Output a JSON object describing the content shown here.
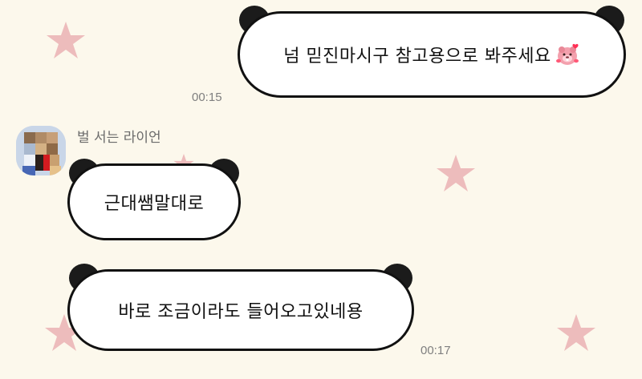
{
  "messages": [
    {
      "id": "m1",
      "side": "right",
      "text": "넘 믿진마시구 참고용으로 봐주세요",
      "emoji": "pink-beaver-emoji",
      "time": "00:15"
    },
    {
      "id": "m2",
      "side": "left",
      "text": "근대쌤말대로",
      "time": ""
    },
    {
      "id": "m3",
      "side": "left",
      "text": "바로 조금이라도 들어오고있네용",
      "time": "00:17"
    }
  ],
  "sender": {
    "name": "벌 서는 라이언",
    "avatar": "pixelated-avatar"
  },
  "theme": {
    "background": "#fcf8ec",
    "bubble_fill": "#ffffff",
    "bubble_border": "#111111",
    "star_color": "#edbcbc",
    "time_color": "#7f7f7f"
  },
  "icons": [
    "star-icon",
    "panda-ear-icon",
    "pink-beaver-emoji"
  ]
}
